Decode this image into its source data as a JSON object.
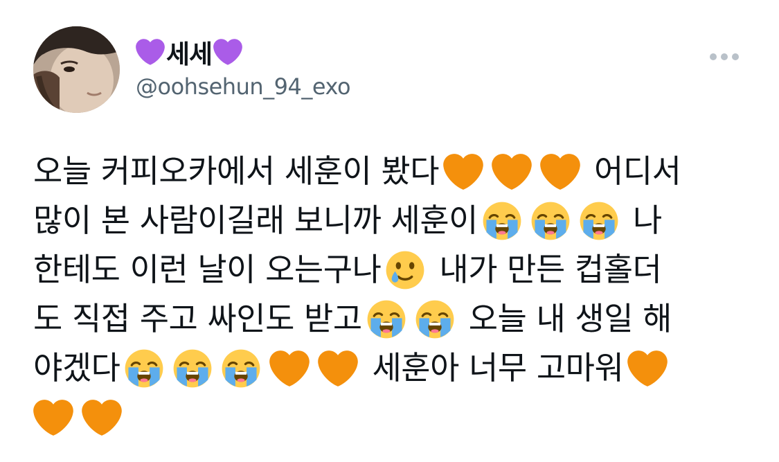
{
  "user": {
    "display_name": "세세",
    "handle": "@oohsehun_94_exo",
    "name_emoji": "purple-heart"
  },
  "colors": {
    "text": "#0f1419",
    "handle": "#536471",
    "orange_heart": "#f4900c",
    "purple_heart": "#9b4dde",
    "face_yellow": "#ffcc4d",
    "tear_blue": "#5dadec"
  },
  "tweet": {
    "l1": {
      "a": "오늘 커피오카에서 세훈이 봤다",
      "b": "어디서"
    },
    "l2": {
      "a": "많이 본 사람이길래 보니까 세훈이",
      "b": "나"
    },
    "l3": {
      "a": "한테도 이런 날이 오는구나",
      "b": "내가 만든 컵홀더"
    },
    "l4": {
      "a": "도 직접 주고 싸인도 받고",
      "b": "오늘 내 생일 해"
    },
    "l5": {
      "a": "야겠다",
      "b": "세훈아 너무 고마워"
    }
  }
}
